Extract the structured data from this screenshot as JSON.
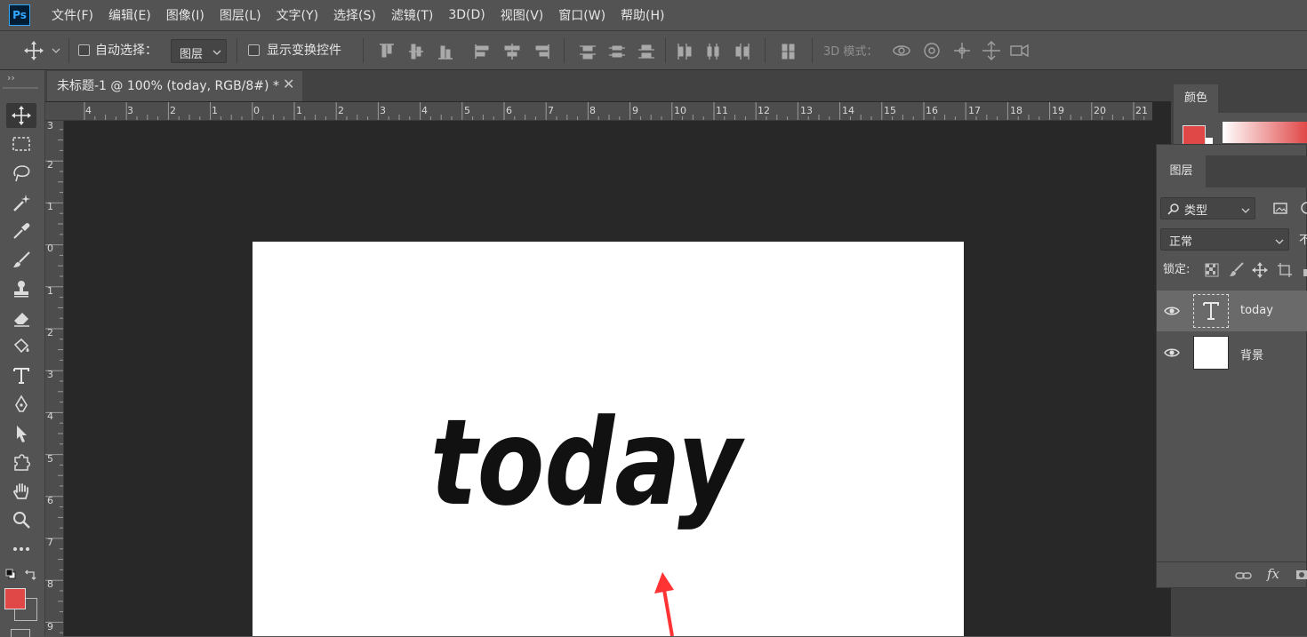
{
  "app": {
    "logo": "Ps"
  },
  "menu": [
    "文件(F)",
    "编辑(E)",
    "图像(I)",
    "图层(L)",
    "文字(Y)",
    "选择(S)",
    "滤镜(T)",
    "3D(D)",
    "视图(V)",
    "窗口(W)",
    "帮助(H)"
  ],
  "options": {
    "auto_select_label": "自动选择：",
    "auto_select_target": "图层",
    "show_transform_label": "显示变换控件",
    "mode_3d_label": "3D 模式："
  },
  "document": {
    "tab_title": "未标题-1 @ 100% (today, RGB/8#) *",
    "canvas_text": "today",
    "hruler_labels": [
      "4",
      "3",
      "2",
      "1",
      "0",
      "1",
      "2",
      "3",
      "4",
      "5",
      "6",
      "7",
      "8",
      "9",
      "10",
      "11",
      "12",
      "13",
      "14",
      "15",
      "16",
      "17",
      "18",
      "19",
      "20",
      "21"
    ],
    "vruler_labels": [
      "3",
      "2",
      "1",
      "0",
      "1",
      "2",
      "3",
      "4",
      "5",
      "6",
      "7",
      "8",
      "9"
    ]
  },
  "colors": {
    "foreground": "#e04848",
    "background": "#ffffff",
    "arrow": "#ff3333",
    "ps_blue": "#31a8ff"
  },
  "color_panel": {
    "tab": "颜色"
  },
  "layers_panel": {
    "tab": "图层",
    "filter_label": "类型",
    "blend_mode": "正常",
    "opacity_label_partial": "不",
    "lock_label": "锁定:",
    "layers": [
      {
        "name": "today",
        "type": "text",
        "selected": true,
        "visible": true
      },
      {
        "name": "背景",
        "type": "background",
        "selected": false,
        "visible": true
      }
    ]
  }
}
